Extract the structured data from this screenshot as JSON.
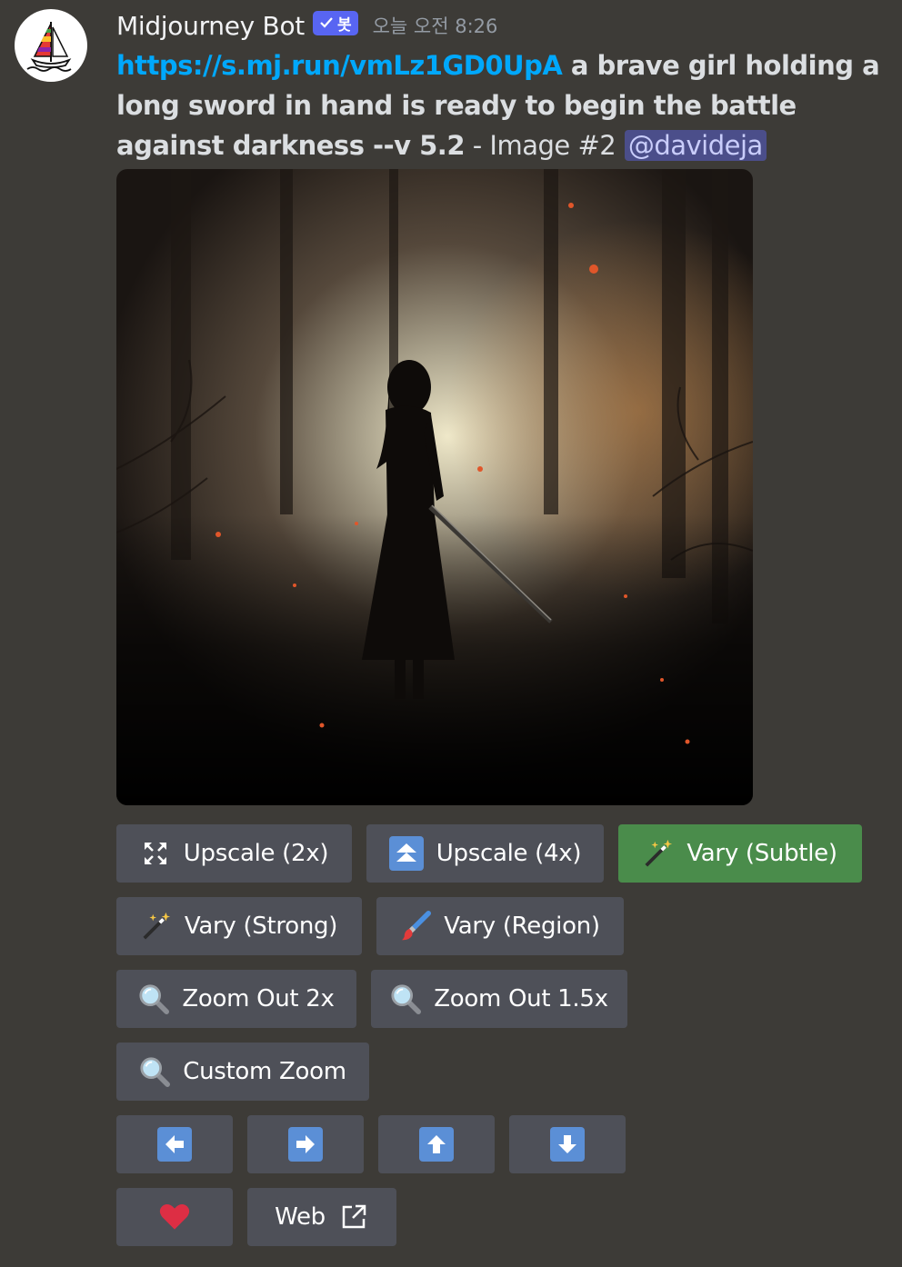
{
  "message": {
    "username": "Midjourney Bot",
    "bot_tag": "봇",
    "timestamp": "오늘 오전 8:26",
    "link": "https://s.mj.run/vmLz1GD0UpA",
    "prompt": " a brave girl holding a long sword in hand is ready to begin the battle against darkness --v 5.2",
    "separator": " - ",
    "image_label": "Image #2",
    "space": " ",
    "mention": "@davideja"
  },
  "buttons": {
    "upscale_2x": "Upscale (2x)",
    "upscale_4x": "Upscale (4x)",
    "vary_subtle": "Vary (Subtle)",
    "vary_strong": "Vary (Strong)",
    "vary_region": "Vary (Region)",
    "zoom_out_2x": "Zoom Out 2x",
    "zoom_out_15x": "Zoom Out 1.5x",
    "custom_zoom": "Custom Zoom",
    "web": "Web"
  },
  "icons": {
    "upscale_2x": "expand-arrows-icon",
    "upscale_4x": "double-up-arrow-icon",
    "vary": "magic-wand-icon",
    "vary_region": "paintbrush-icon",
    "zoom": "magnifying-glass-icon",
    "pan": [
      "arrow-left-icon",
      "arrow-right-icon",
      "arrow-up-icon",
      "arrow-down-icon"
    ],
    "favorite": "heart-icon",
    "web": "external-link-icon"
  },
  "colors": {
    "background": "#3d3b37",
    "button": "#4e5058",
    "button_active": "#4a8c4b",
    "link": "#00a8fc",
    "bot_tag": "#5865f2",
    "mention_bg": "#4b4e8a"
  }
}
